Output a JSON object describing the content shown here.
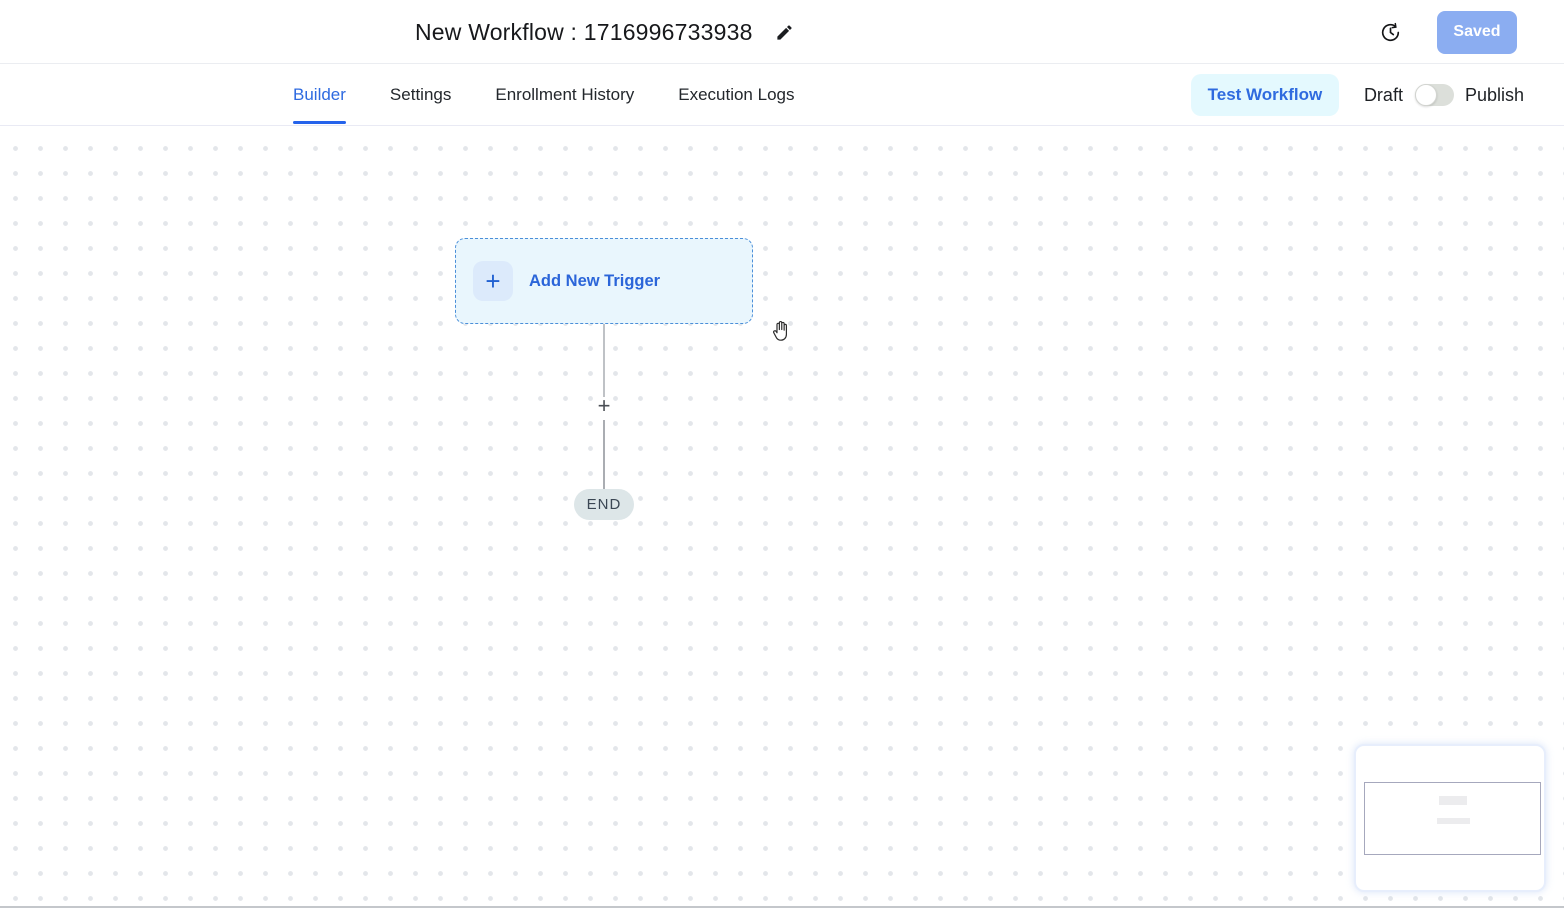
{
  "header": {
    "title": "New Workflow : 1716996733938",
    "saved_button": "Saved",
    "edit_icon": "pencil-icon",
    "history_icon": "history-clock-icon"
  },
  "tabs": [
    {
      "label": "Builder",
      "active": true
    },
    {
      "label": "Settings",
      "active": false
    },
    {
      "label": "Enrollment History",
      "active": false
    },
    {
      "label": "Execution Logs",
      "active": false
    }
  ],
  "toolbar": {
    "test_workflow_label": "Test Workflow",
    "draft_label": "Draft",
    "publish_label": "Publish",
    "publish_toggle_state": "off"
  },
  "canvas": {
    "trigger_node": {
      "plus": "+",
      "label": "Add New Trigger"
    },
    "connector_add": "+",
    "end_node_label": "END",
    "cursor": "open-hand-grab-cursor"
  },
  "colors": {
    "accent_blue": "#2563eb",
    "active_tab": "#2e6ae0",
    "saved_button_bg": "#8badf1",
    "test_workflow_bg": "#e4f9fe",
    "trigger_border": "#4b8fd9",
    "trigger_bg": "#e9f6fd",
    "trigger_chip_bg": "#dceafb",
    "end_pill_bg": "#dde6e8",
    "dot_grid": "#e3e6ea"
  }
}
